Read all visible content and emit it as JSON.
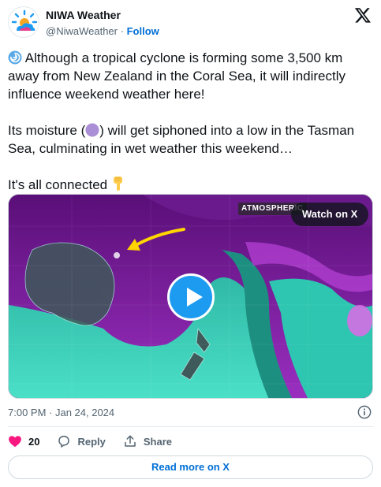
{
  "user": {
    "display_name": "NIWA Weather",
    "handle": "@NiwaWeather",
    "separator": "·",
    "follow_label": "Follow",
    "avatar_icon": "niwa-logo-icon"
  },
  "tweet": {
    "line1": "Although a tropical cyclone is forming some 3,500 km away from New Zealand in the Coral Sea, it will indirectly influence weekend weather here!",
    "line2_before": "Its moisture (",
    "line2_after": ") will get siphoned into a low in the Tasman Sea, culminating in wet weather this weekend…",
    "line3": "It's all connected",
    "icons": [
      "cyclone-emoji-icon",
      "purple-circle-emoji-icon",
      "pointing-down-emoji-icon"
    ]
  },
  "media": {
    "badge": "ATMOSPHERIC",
    "watch_label": "Watch on X",
    "play_icon": "play-icon"
  },
  "meta": {
    "timestamp": "7:00 PM · Jan 24, 2024"
  },
  "actions": {
    "likes": "20",
    "reply_label": "Reply",
    "share_label": "Share"
  },
  "footer": {
    "read_more_label": "Read more on X"
  },
  "colors": {
    "link_blue": "#006fd6",
    "play_blue": "#1d9bf0",
    "heart_pink": "#f91880",
    "muted_gray": "#536471",
    "moisture_purple": "#8f2fb0",
    "ocean_teal": "#3ed8c0"
  }
}
